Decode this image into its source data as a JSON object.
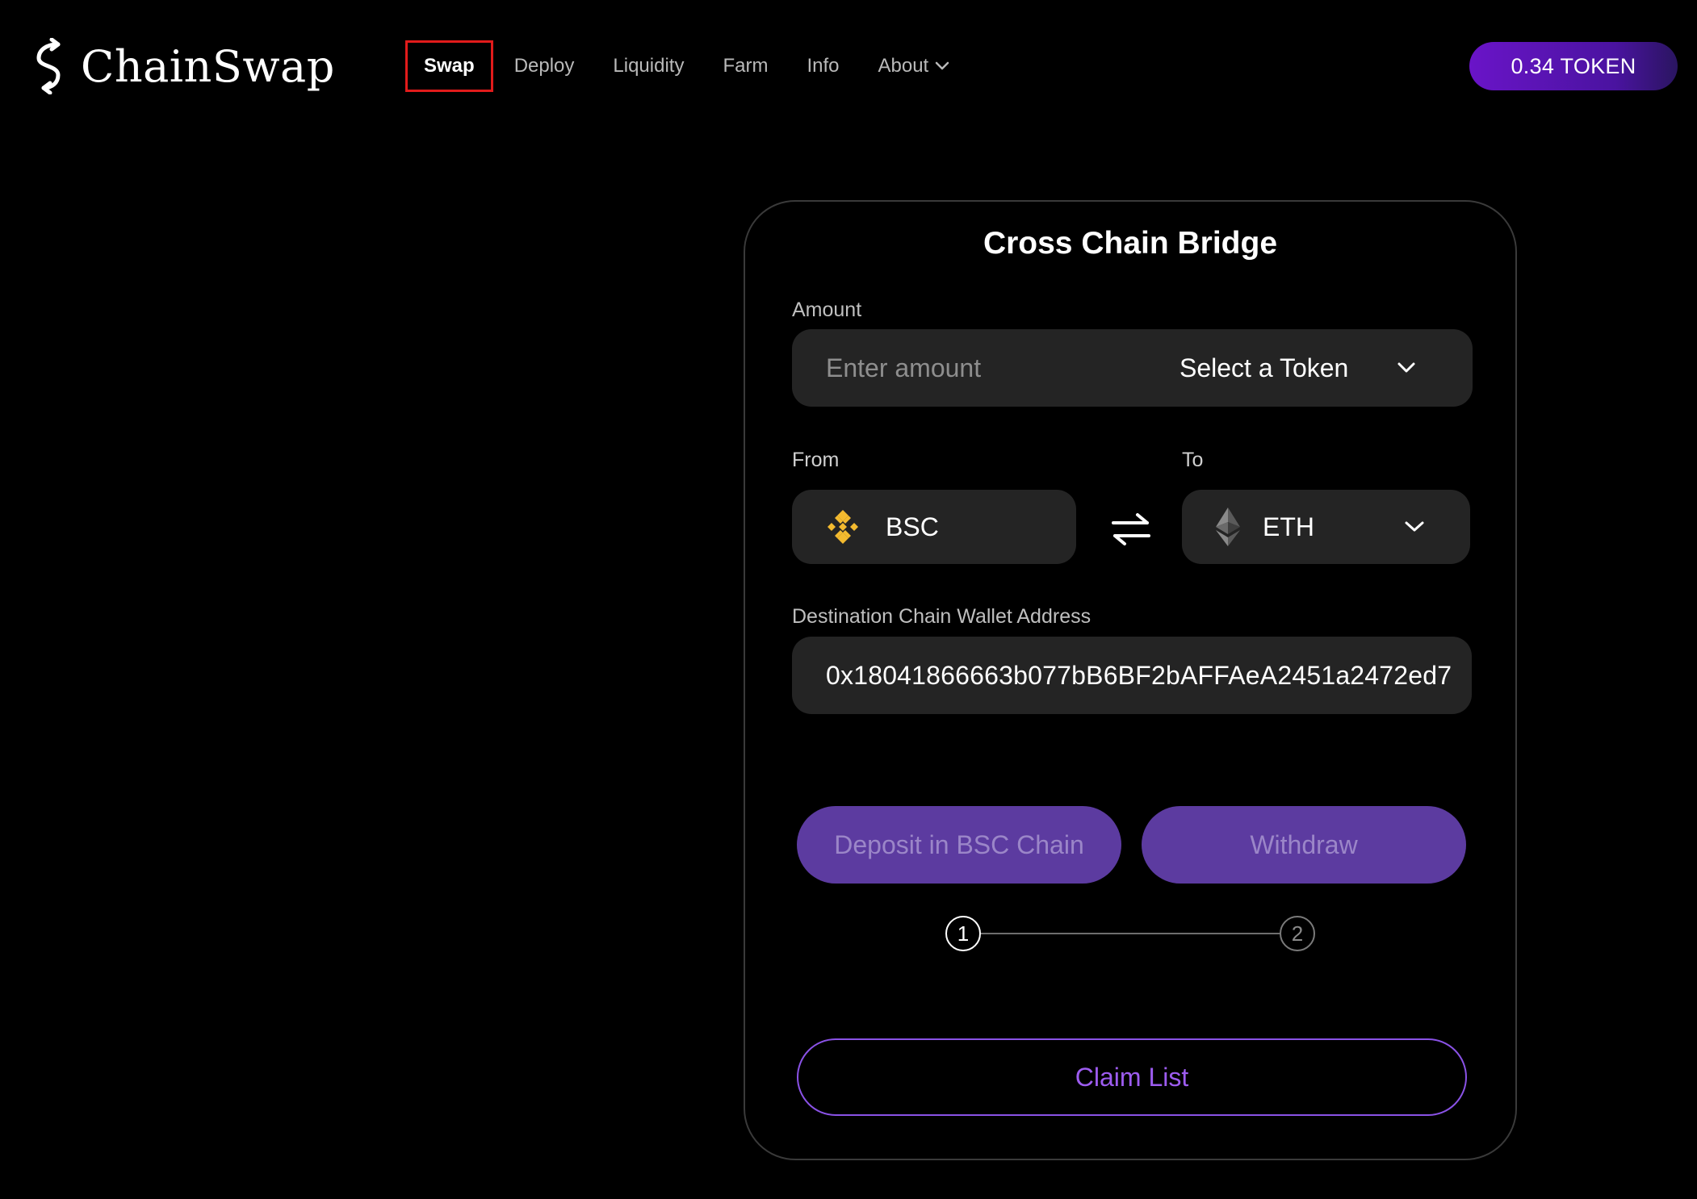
{
  "app": {
    "name": "ChainSwap",
    "logo_icon": "chainswap-s-icon"
  },
  "nav": {
    "items": [
      {
        "label": "Swap",
        "active": true
      },
      {
        "label": "Deploy"
      },
      {
        "label": "Liquidity"
      },
      {
        "label": "Farm"
      },
      {
        "label": "Info"
      },
      {
        "label": "About",
        "has_dropdown": true
      }
    ]
  },
  "wallet": {
    "token_balance": "0.34 TOKEN"
  },
  "bridge": {
    "title": "Cross Chain Bridge",
    "amount_label": "Amount",
    "amount_placeholder": "Enter amount",
    "amount_value": "",
    "token_select": "Select a Token",
    "from_label": "From",
    "from_chain": "BSC",
    "from_icon": "binance-icon",
    "to_label": "To",
    "to_chain": "ETH",
    "to_icon": "ethereum-icon",
    "address_label": "Destination Chain Wallet Address",
    "address_value": "0x18041866663b077bB6BF2bAFFAeA2451a2472ed7",
    "deposit_label": "Deposit in BSC Chain",
    "withdraw_label": "Withdraw",
    "steps": [
      "1",
      "2"
    ],
    "current_step": 1,
    "claim_label": "Claim List"
  },
  "colors": {
    "background": "#000000",
    "accent": "#5c3ba0",
    "accent_text": "#9d5cf0",
    "highlight_box": "#e11b1b",
    "binance_yellow": "#f3ba2f"
  }
}
